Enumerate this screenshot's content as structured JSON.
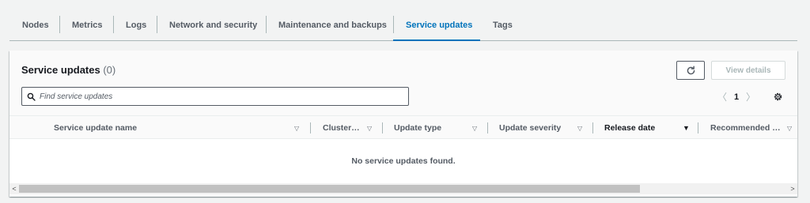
{
  "tabs": [
    {
      "label": "Nodes",
      "active": false
    },
    {
      "label": "Metrics",
      "active": false
    },
    {
      "label": "Logs",
      "active": false
    },
    {
      "label": "Network and security",
      "active": false
    },
    {
      "label": "Maintenance and backups",
      "active": false
    },
    {
      "label": "Service updates",
      "active": true
    },
    {
      "label": "Tags",
      "active": false
    }
  ],
  "panel": {
    "title": "Service updates",
    "count": "(0)",
    "view_details_label": "View details",
    "search_placeholder": "Find service updates",
    "page_number": "1",
    "empty_message": "No service updates found."
  },
  "table": {
    "columns": [
      {
        "label": "Service update name",
        "sort": "none"
      },
      {
        "label": "Cluster…",
        "sort": "none"
      },
      {
        "label": "Update type",
        "sort": "none"
      },
      {
        "label": "Update severity",
        "sort": "none"
      },
      {
        "label": "Release date",
        "sort": "descending"
      },
      {
        "label": "Recommended …",
        "sort": "none"
      }
    ]
  },
  "icons": {
    "refresh": "refresh-icon",
    "search": "search-icon",
    "settings": "gear-icon",
    "prev": "chevron-left-icon",
    "next": "chevron-right-icon"
  },
  "colors": {
    "active_tab": "#0073bb",
    "background": "#f2f3f3",
    "text": "#16191f",
    "muted": "#545b64"
  }
}
